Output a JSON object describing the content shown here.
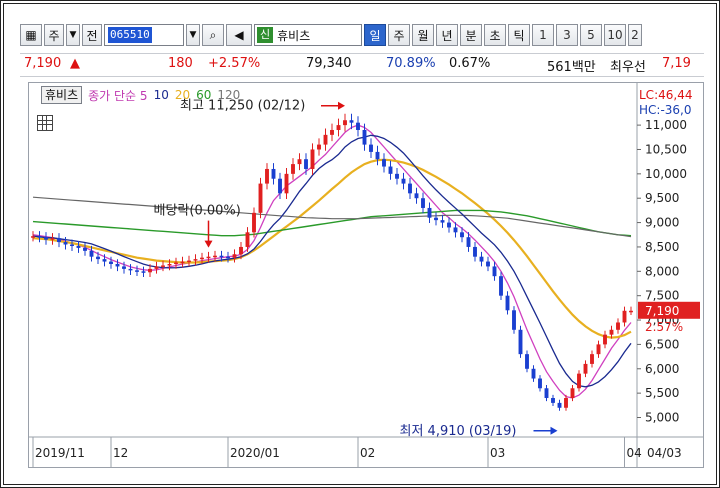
{
  "toolbar": {
    "market_btn": "주",
    "prev_btn": "전",
    "stock_code": "065510",
    "stock_name": "휴비츠",
    "new_badge": "신",
    "timeframes": [
      "일",
      "주",
      "월",
      "년",
      "분",
      "초",
      "틱"
    ],
    "active_timeframe": "일",
    "numbers": [
      "1",
      "3",
      "5",
      "10",
      "2"
    ]
  },
  "ticker": {
    "price": "7,190",
    "arrow": "▲",
    "change": "180",
    "change_pct": "+2.57%",
    "volume": "79,340",
    "volume_ratio": "70.89%",
    "turnover": "0.67%",
    "amount": "561백만",
    "label": "최우선",
    "best_price": "7,19"
  },
  "legend": {
    "name": "휴비츠",
    "ma_label": "종가 단순 5",
    "ma10": "10",
    "ma20": "20",
    "ma60": "60",
    "ma120": "120",
    "lc": "LC:46,44",
    "hc": "HC:-36,0"
  },
  "annotations": {
    "high": "최고 11,250 (02/12)",
    "low": "최저 4,910 (03/19)",
    "dividend": "배당락(0.00%)"
  },
  "colors": {
    "up": "#e02020",
    "down": "#1a3fd0",
    "ma5": "#d040c0",
    "ma10": "#1a2a90",
    "ma20": "#e8b020",
    "ma60": "#2a9a2a",
    "ma120": "#666666"
  },
  "price_tag": {
    "price": "7,190",
    "pct": "2.57%"
  },
  "chart_data": {
    "type": "line",
    "title": "",
    "y_ticks": [
      "11,000",
      "10,500",
      "10,000",
      "9,500",
      "9,000",
      "8,500",
      "8,000",
      "7,500",
      "7,000",
      "6,500",
      "6,000",
      "5,500",
      "5,000"
    ],
    "ylim": [
      4600,
      11700
    ],
    "x_ticks": [
      {
        "label": "2019/11",
        "i": 0
      },
      {
        "label": "12",
        "i": 12
      },
      {
        "label": "2020/01",
        "i": 30
      },
      {
        "label": "02",
        "i": 50
      },
      {
        "label": "03",
        "i": 70
      },
      {
        "label": "04",
        "i": 91
      }
    ],
    "x_last_label": "04/03",
    "n": 93,
    "series": [
      {
        "name": "close",
        "values": [
          8720,
          8700,
          8650,
          8680,
          8600,
          8550,
          8520,
          8480,
          8420,
          8300,
          8250,
          8200,
          8150,
          8100,
          8050,
          8020,
          8000,
          7980,
          8050,
          8100,
          8120,
          8150,
          8180,
          8200,
          8220,
          8250,
          8280,
          8300,
          8320,
          8300,
          8280,
          8350,
          8500,
          8800,
          9200,
          9800,
          10100,
          9900,
          9600,
          10000,
          10200,
          10300,
          10100,
          10500,
          10600,
          10800,
          10900,
          11000,
          11100,
          11050,
          10900,
          10600,
          10450,
          10300,
          10150,
          10000,
          9900,
          9800,
          9600,
          9500,
          9300,
          9100,
          9050,
          9000,
          8900,
          8800,
          8700,
          8500,
          8300,
          8200,
          8100,
          7900,
          7500,
          7200,
          6800,
          6300,
          6000,
          5800,
          5600,
          5400,
          5300,
          5200,
          5400,
          5600,
          5900,
          6100,
          6300,
          6500,
          6700,
          6800,
          6950,
          7190,
          7190
        ]
      },
      {
        "name": "MA5",
        "values": [
          8750,
          8730,
          8710,
          8690,
          8660,
          8620,
          8580,
          8540,
          8490,
          8430,
          8360,
          8300,
          8240,
          8190,
          8140,
          8090,
          8060,
          8030,
          8020,
          8030,
          8060,
          8090,
          8120,
          8150,
          8170,
          8190,
          8220,
          8240,
          8260,
          8280,
          8300,
          8310,
          8350,
          8450,
          8630,
          8900,
          9200,
          9450,
          9600,
          9750,
          9850,
          9950,
          10050,
          10150,
          10280,
          10400,
          10550,
          10700,
          10850,
          10950,
          11000,
          10950,
          10850,
          10700,
          10550,
          10400,
          10250,
          10100,
          9950,
          9800,
          9650,
          9500,
          9350,
          9200,
          9100,
          8980,
          8880,
          8770,
          8640,
          8500,
          8360,
          8200,
          8000,
          7760,
          7480,
          7140,
          6800,
          6500,
          6200,
          5940,
          5740,
          5560,
          5430,
          5400,
          5460,
          5580,
          5760,
          5980,
          6200,
          6420,
          6600,
          6790,
          6950
        ]
      },
      {
        "name": "MA20",
        "values": [
          8680,
          8670,
          8660,
          8640,
          8620,
          8600,
          8580,
          8550,
          8520,
          8490,
          8460,
          8430,
          8400,
          8370,
          8340,
          8310,
          8280,
          8260,
          8240,
          8220,
          8210,
          8200,
          8190,
          8180,
          8180,
          8180,
          8190,
          8200,
          8210,
          8220,
          8230,
          8250,
          8290,
          8350,
          8430,
          8520,
          8620,
          8720,
          8820,
          8920,
          9020,
          9120,
          9230,
          9340,
          9450,
          9570,
          9690,
          9800,
          9920,
          10030,
          10120,
          10200,
          10250,
          10280,
          10290,
          10280,
          10260,
          10230,
          10190,
          10140,
          10080,
          10010,
          9940,
          9860,
          9780,
          9690,
          9600,
          9500,
          9400,
          9290,
          9180,
          9060,
          8930,
          8790,
          8640,
          8480,
          8310,
          8130,
          7950,
          7770,
          7590,
          7420,
          7260,
          7110,
          6980,
          6870,
          6780,
          6710,
          6660,
          6640,
          6650,
          6690,
          6760
        ]
      },
      {
        "name": "MA60",
        "values": [
          9020,
          9010,
          9000,
          8990,
          8980,
          8970,
          8960,
          8950,
          8940,
          8930,
          8920,
          8910,
          8900,
          8890,
          8880,
          8870,
          8860,
          8850,
          8840,
          8830,
          8820,
          8810,
          8800,
          8790,
          8780,
          8770,
          8760,
          8750,
          8740,
          8730,
          8730,
          8730,
          8740,
          8750,
          8760,
          8780,
          8800,
          8820,
          8840,
          8860,
          8880,
          8900,
          8920,
          8940,
          8960,
          8980,
          9000,
          9020,
          9040,
          9060,
          9080,
          9100,
          9120,
          9130,
          9140,
          9150,
          9160,
          9170,
          9180,
          9190,
          9200,
          9210,
          9220,
          9230,
          9240,
          9250,
          9250,
          9250,
          9250,
          9250,
          9240,
          9230,
          9220,
          9200,
          9180,
          9160,
          9140,
          9110,
          9080,
          9050,
          9020,
          8990,
          8960,
          8930,
          8900,
          8870,
          8840,
          8810,
          8790,
          8770,
          8750,
          8740,
          8730
        ]
      },
      {
        "name": "MA120",
        "values": [
          9520,
          9510,
          9500,
          9490,
          9480,
          9470,
          9460,
          9450,
          9440,
          9430,
          9420,
          9410,
          9400,
          9390,
          9380,
          9370,
          9360,
          9350,
          9340,
          9330,
          9320,
          9310,
          9300,
          9290,
          9280,
          9270,
          9260,
          9250,
          9240,
          9230,
          9220,
          9210,
          9200,
          9190,
          9180,
          9170,
          9160,
          9150,
          9140,
          9130,
          9120,
          9110,
          9100,
          9095,
          9090,
          9085,
          9080,
          9080,
          9080,
          9080,
          9080,
          9085,
          9090,
          9095,
          9100,
          9105,
          9110,
          9115,
          9120,
          9125,
          9130,
          9135,
          9140,
          9145,
          9150,
          9150,
          9150,
          9145,
          9140,
          9130,
          9120,
          9110,
          9100,
          9090,
          9070,
          9050,
          9030,
          9010,
          8990,
          8970,
          8950,
          8930,
          8910,
          8890,
          8870,
          8850,
          8830,
          8810,
          8790,
          8770,
          8750,
          8730,
          8710
        ]
      }
    ],
    "high_index": 48,
    "low_index": 81,
    "dividend_index": 27
  }
}
